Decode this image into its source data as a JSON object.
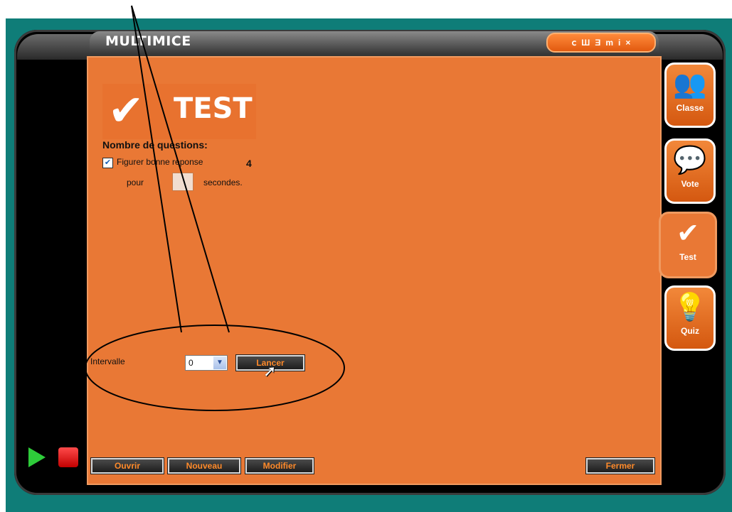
{
  "app": {
    "title": "MULTIMICE"
  },
  "window_controls": [
    "ⅽ",
    "Ш",
    "Ǝ",
    "m",
    "i",
    "×"
  ],
  "test_header": {
    "label": "TEST"
  },
  "questions": {
    "label": "Nombre de questions:",
    "count": "4",
    "show_answer_checked": true,
    "show_answer_label": "Figurer bonne reponse",
    "pour_label": "pour",
    "seconds_value": "",
    "seconds_label": "secondes."
  },
  "interval": {
    "label": "Intervalle",
    "value": "0",
    "launch_label": "Lancer"
  },
  "bottom_buttons": {
    "open": "Ouvrir",
    "new": "Nouveau",
    "modify": "Modifier",
    "close": "Fermer"
  },
  "side_tabs": [
    {
      "label": "Classe",
      "icon": "people-icon"
    },
    {
      "label": "Vote",
      "icon": "speech-bubble-icon"
    },
    {
      "label": "Test",
      "icon": "checkmark-icon",
      "active": true
    },
    {
      "label": "Quiz",
      "icon": "lightbulb-icon"
    }
  ],
  "colors": {
    "panel": "#e97835",
    "background": "#0f7d78",
    "button_text": "#ff8a2a"
  }
}
